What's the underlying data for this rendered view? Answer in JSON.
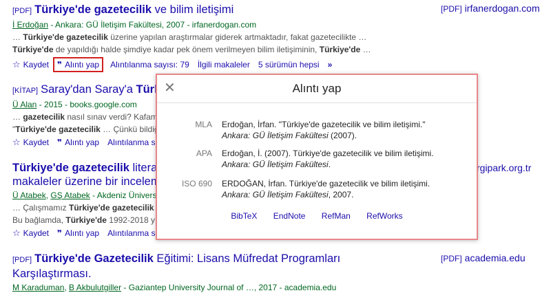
{
  "results": [
    {
      "tag": "[PDF]",
      "title_bold": "Türkiye'de gazetecilik",
      "title_rest": " ve bilim iletişimi",
      "meta_author": "İ Erdoğan",
      "meta_rest": " - Ankara: GÜ İletişim Fakültesi, 2007 - irfanerdogan.com",
      "snippet1_pre": "… ",
      "snippet1_bold": "Türkiye'de gazetecilik",
      "snippet1_post": " üzerine yapılan araştırmalar giderek artmaktadır, fakat gazetecilikte …",
      "snippet2_bold": "Türkiye'de",
      "snippet2_mid": " de yapıldığı halde şimdiye kadar pek önem verilmeyen bilim iletişiminin, ",
      "snippet2_bold2": "Türkiye'de",
      "snippet2_post": " …",
      "actions": [
        "Kaydet",
        "Alıntı yap",
        "Alıntılanma sayısı: 79",
        "İlgili makaleler",
        "5 sürümün hepsi"
      ]
    },
    {
      "tag": "[KİTAP]",
      "title_bold": "",
      "title_rest": "Saray'dan Saray'a ",
      "title_bold2": "Türkiy",
      "meta_author": "Ü Alan",
      "meta_rest": " - 2015 - books.google.com",
      "snippet1_pre": "… ",
      "snippet1_bold": "gazetecilik",
      "snippet1_post": " nasıl sınav verdi? Kafam",
      "snippet2_pre": "\"",
      "snippet2_bold": "Türkiye'de gazetecilik",
      "snippet2_post": " … Çünkü bildiğ",
      "actions": [
        "Kaydet",
        "Alıntı yap",
        "Alıntılanma s"
      ]
    },
    {
      "title_bold": "Türkiye'de gazetecilik",
      "title_rest": " literatü",
      "title_line2": "makaleler üzerine bir inceleme",
      "meta_author": "Ü Atabek",
      "meta_sep": ", ",
      "meta_author2": "GŞ Atabek",
      "meta_rest": " - Akdeniz Üniversi",
      "snippet1_pre": "… Çalışmamız ",
      "snippet1_bold": "Türkiye'de gazetecilik",
      "snippet1_post": " li",
      "snippet2_pre": "Bu bağlamda, ",
      "snippet2_bold": "Türkiye'de",
      "snippet2_post": " 1992-2018 yıl",
      "actions": [
        "Kaydet",
        "Alıntı yap",
        "Alıntılanma s"
      ]
    },
    {
      "tag": "[PDF]",
      "title_bold": "Türkiye'de Gazetecilik",
      "title_rest": " Eğitimi: Lisans Müfredat Programları",
      "title_line2": "Karşılaştırması.",
      "meta_author": "M Karaduman",
      "meta_sep": ", ",
      "meta_author2": "B Akbulutgiller",
      "meta_rest": " - Gaziantep University Journal of …, 2017 - academia.edu"
    }
  ],
  "right_links": [
    {
      "tag": "[PDF]",
      "text": "irfanerdogan.com"
    },
    {
      "text": "rgipark.org.tr"
    },
    {
      "tag": "[PDF]",
      "text": "academia.edu"
    }
  ],
  "dialog": {
    "close_glyph": "✕",
    "title": "Alıntı yap",
    "citations": [
      {
        "label": "MLA",
        "text_pre": "Erdoğan, İrfan. \"Türkiye'de gazetecilik ve bilim iletişimi.\" ",
        "text_italic": "Ankara: GÜ İletişim Fakültesi",
        "text_post": " (2007)."
      },
      {
        "label": "APA",
        "text_pre": "Erdoğan, İ. (2007). Türkiye'de gazetecilik ve bilim iletişimi. ",
        "text_italic": "Ankara: GÜ İletişim Fakültesi",
        "text_post": "."
      },
      {
        "label": "ISO 690",
        "text_pre": "ERDOĞAN, İrfan. Türkiye'de gazetecilik ve bilim iletişimi. ",
        "text_italic": "Ankara: GÜ İletişim Fakültesi",
        "text_post": ", 2007."
      }
    ],
    "exports": [
      "BibTeX",
      "EndNote",
      "RefMan",
      "RefWorks"
    ]
  },
  "icons": {
    "star": "☆",
    "quote": "❞",
    "double_chevron": "»"
  },
  "colors": {
    "link": "#1a0dab",
    "meta": "#006621",
    "highlight_border": "#d21f1f",
    "dialog_border": "#e9868a"
  }
}
